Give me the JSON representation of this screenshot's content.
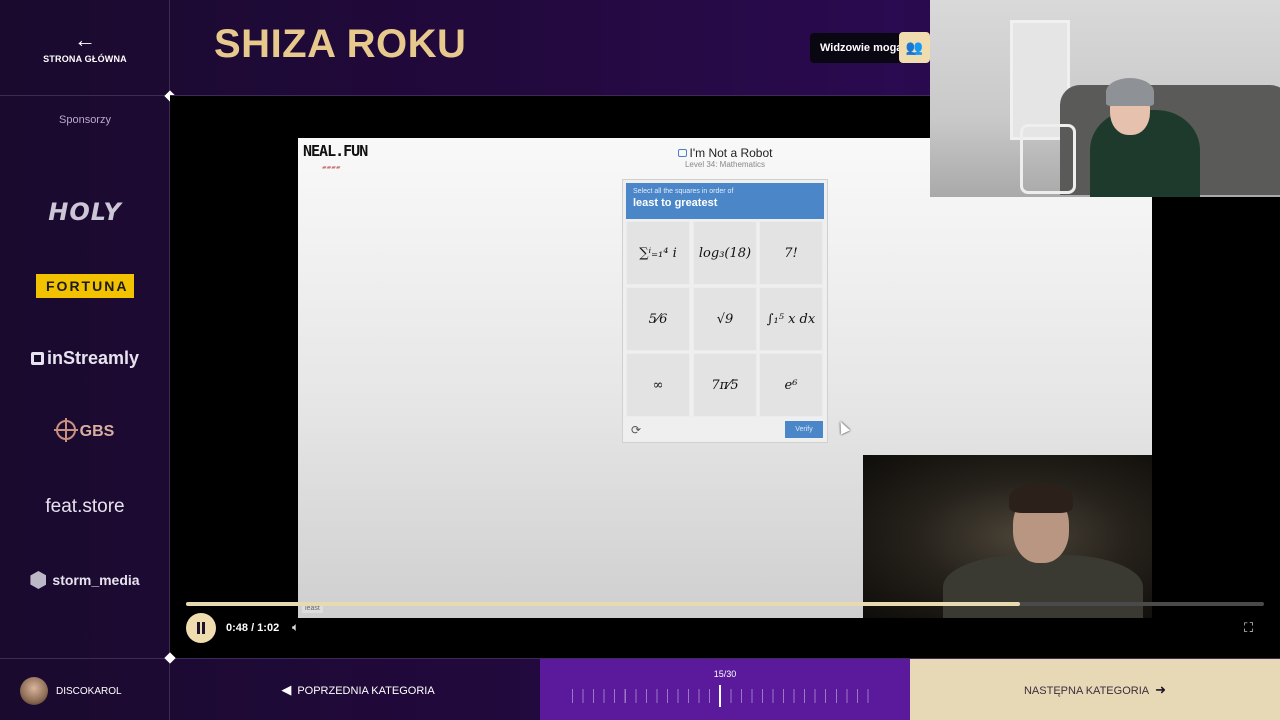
{
  "sidebar": {
    "home_label": "STRONA GŁÓWNA",
    "sponsors_title": "Sponsorzy",
    "sponsors": [
      "HOLY",
      "FORTUNA",
      "inStreamly",
      "GBS",
      "feat.store",
      "storm_media"
    ]
  },
  "header": {
    "title": "SHIZA ROKU",
    "viewers_label": "Widzowie mogą"
  },
  "game": {
    "brand": "NEAL.FUN",
    "title": "I'm Not a Robot",
    "level": "Level 34: Mathematics",
    "instruction_small": "Select all the squares in order of",
    "instruction_big": "least to greatest",
    "cells": [
      "∑ⁱ₌₁⁴ i",
      "log₃(18)",
      "7!",
      "5⁄6",
      "√9",
      "∫₁⁵ x dx",
      "∞",
      "7π⁄5",
      "e⁶"
    ],
    "verify_label": "Verify",
    "tag": "least"
  },
  "player": {
    "time": "0:48 / 1:02",
    "progress": 0.774
  },
  "footer": {
    "username": "DISCOKAROL",
    "prev_label": "POPRZEDNIA KATEGORIA",
    "counter": "15/30",
    "next_label": "NASTĘPNA KATEGORIA"
  }
}
